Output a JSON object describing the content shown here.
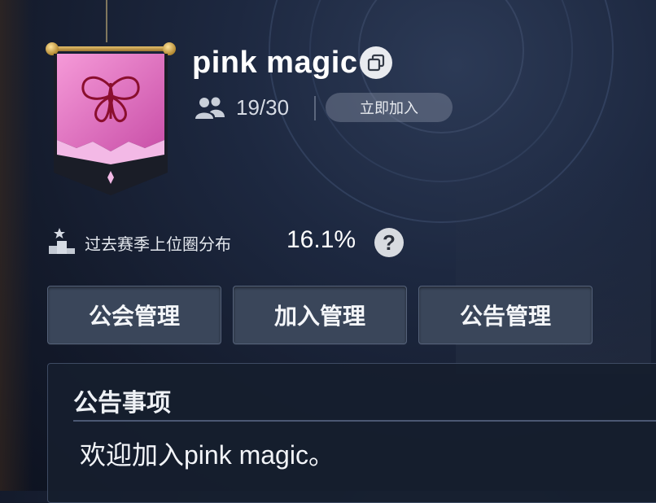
{
  "guild": {
    "name": "pink magic",
    "members": "19/30",
    "join_label": "立即加入",
    "emblem_icon": "butterfly-icon",
    "emblem_color": "#e872c8"
  },
  "season": {
    "label": "过去赛季上位圈分布",
    "value": "16.1%",
    "help_label": "?"
  },
  "tabs": [
    {
      "label": "公会管理"
    },
    {
      "label": "加入管理"
    },
    {
      "label": "公告管理"
    }
  ],
  "notice": {
    "title": "公告事项",
    "text": "欢迎加入pink magic。"
  }
}
